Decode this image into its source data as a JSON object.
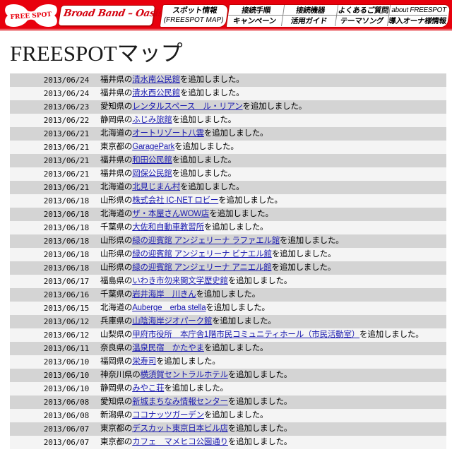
{
  "header": {
    "logo_text": "FREE SPOT",
    "brand_pill": "Broad Band – Oasis",
    "spot_tab": {
      "line1": "スポット情報",
      "line2": "(FREESPOT MAP)"
    },
    "nav": [
      {
        "label": "接続手順",
        "style": "bold"
      },
      {
        "label": "接続機器",
        "style": "bold"
      },
      {
        "label": "よくあるご質問",
        "style": "bold"
      },
      {
        "label": "about FREESPOT",
        "style": "plain"
      },
      {
        "label": "キャンペーン",
        "style": "bold"
      },
      {
        "label": "活用ガイド",
        "style": "bold"
      },
      {
        "label": "テーマソング",
        "style": "bold"
      },
      {
        "label": "導入オーナ様情報",
        "style": "bold"
      }
    ],
    "brand_color": "#e8000d",
    "pill_text_color": "#d4000d"
  },
  "page_title": "FREESPOTマップ",
  "news": {
    "link_color": "#1a1ab0",
    "row_odd_bg": "#d4d4d4",
    "row_even_bg": "#f4f4f4",
    "suffix": "を追加しました。",
    "items": [
      {
        "date": "2013/06/24",
        "pref": "福井県の",
        "link": "清水南公民館"
      },
      {
        "date": "2013/06/24",
        "pref": "福井県の",
        "link": "清水西公民館"
      },
      {
        "date": "2013/06/23",
        "pref": "愛知県の",
        "link": "レンタルスペース　ル・リアン"
      },
      {
        "date": "2013/06/22",
        "pref": "静岡県の",
        "link": "ふじみ旅館"
      },
      {
        "date": "2013/06/21",
        "pref": "北海道の",
        "link": "オートリゾート八雲"
      },
      {
        "date": "2013/06/21",
        "pref": "東京都の",
        "link": "GaragePark"
      },
      {
        "date": "2013/06/21",
        "pref": "福井県の",
        "link": "和田公民館"
      },
      {
        "date": "2013/06/21",
        "pref": "福井県の",
        "link": "岡保公民館"
      },
      {
        "date": "2013/06/21",
        "pref": "北海道の",
        "link": "北見じまん村"
      },
      {
        "date": "2013/06/18",
        "pref": "山形県の",
        "link": "株式会社 IC-NET ロビー"
      },
      {
        "date": "2013/06/18",
        "pref": "北海道の",
        "link": "ザ・本屋さんWOW店"
      },
      {
        "date": "2013/06/18",
        "pref": "千葉県の",
        "link": "大佐和自動車教習所"
      },
      {
        "date": "2013/06/18",
        "pref": "山形県の",
        "link": "緑の迎賓館 アンジェリーナ ラファエル館"
      },
      {
        "date": "2013/06/18",
        "pref": "山形県の",
        "link": "緑の迎賓館 アンジェリーナ ビナエル館"
      },
      {
        "date": "2013/06/18",
        "pref": "山形県の",
        "link": "緑の迎賓館 アンジェリーナ アニエル館"
      },
      {
        "date": "2013/06/17",
        "pref": "福島県の",
        "link": "いわき市勿来関文学歴史館"
      },
      {
        "date": "2013/06/16",
        "pref": "千葉県の",
        "link": "岩井海岸　川きん"
      },
      {
        "date": "2013/06/15",
        "pref": "北海道の",
        "link": "Auberge　erba stella"
      },
      {
        "date": "2013/06/12",
        "pref": "兵庫県の",
        "link": "山陰海岸ジオパーク館"
      },
      {
        "date": "2013/06/12",
        "pref": "山梨県の",
        "link": "甲府市役所　本庁舎1階市民コミュニティホール（市民活動室）"
      },
      {
        "date": "2013/06/11",
        "pref": "奈良県の",
        "link": "温泉民宿　かたやま"
      },
      {
        "date": "2013/06/10",
        "pref": "福岡県の",
        "link": "栄寿司"
      },
      {
        "date": "2013/06/10",
        "pref": "神奈川県の",
        "link": "横須賀セントラルホテル"
      },
      {
        "date": "2013/06/10",
        "pref": "静岡県の",
        "link": "みやこ荘"
      },
      {
        "date": "2013/06/08",
        "pref": "愛知県の",
        "link": "新城まちなみ情報センター"
      },
      {
        "date": "2013/06/08",
        "pref": "新潟県の",
        "link": "ココナッツガーデン"
      },
      {
        "date": "2013/06/07",
        "pref": "東京都の",
        "link": "デスカット東京日本ビル店"
      },
      {
        "date": "2013/06/07",
        "pref": "東京都の",
        "link": "カフェ　マメヒコ公園通り"
      }
    ]
  }
}
